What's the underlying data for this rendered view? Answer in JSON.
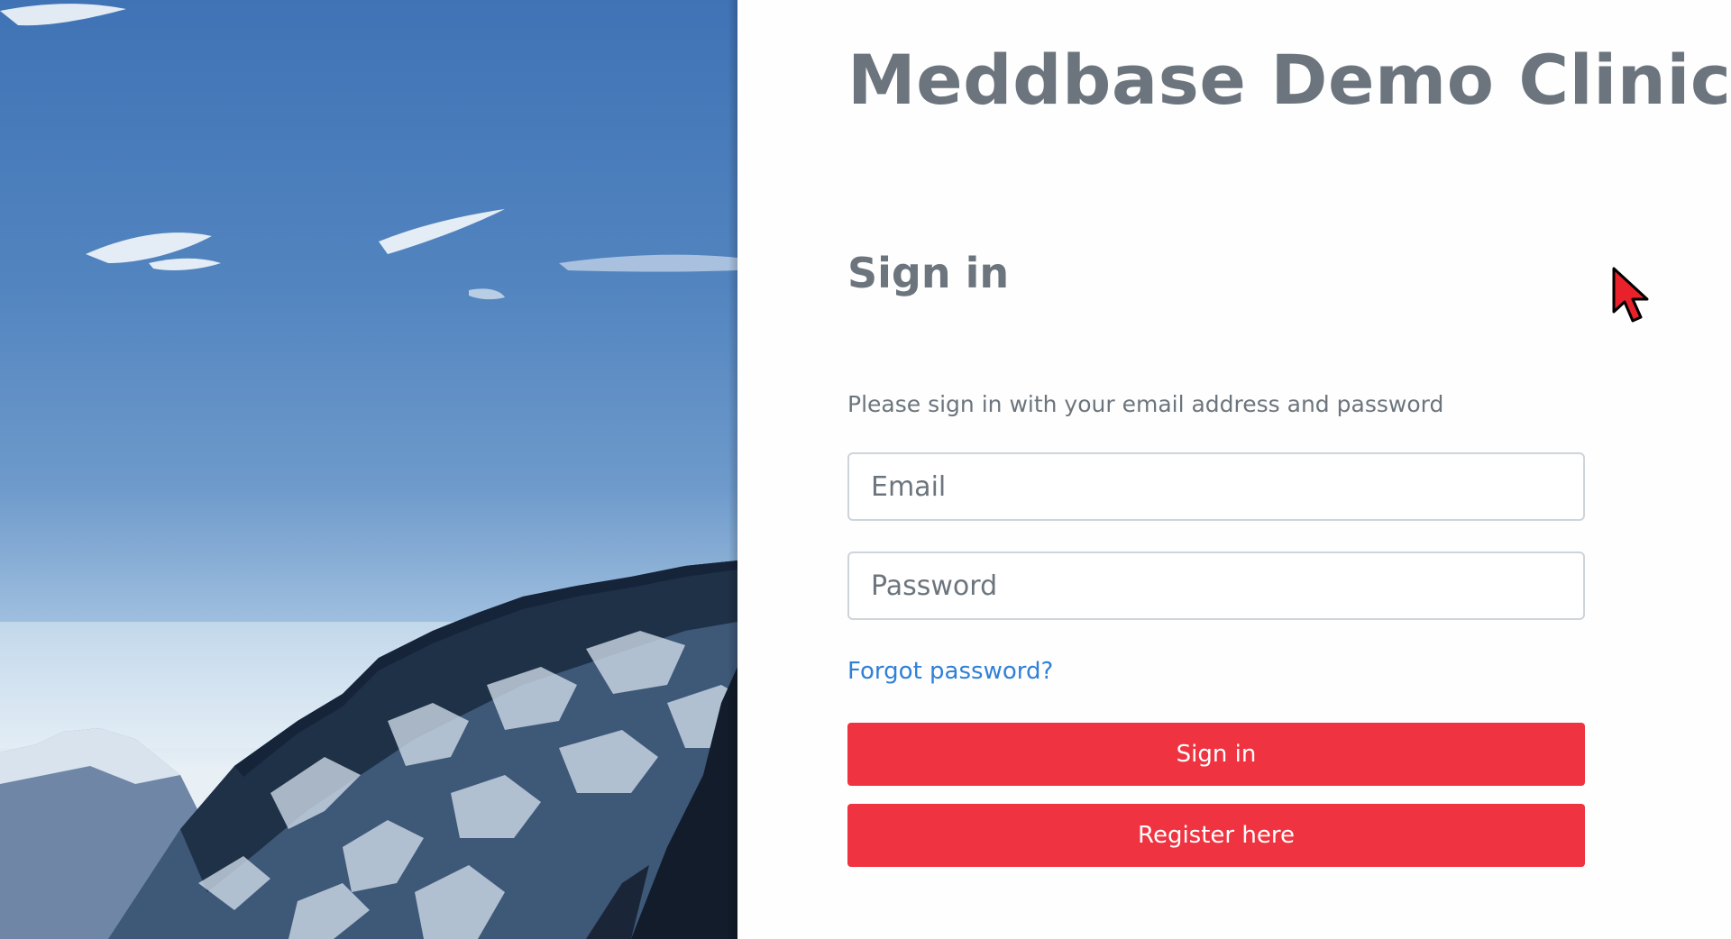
{
  "clinic": {
    "name": "Meddbase Demo Clinic"
  },
  "signin": {
    "heading": "Sign in",
    "instructions": "Please sign in with your email address and password",
    "email_placeholder": "Email",
    "password_placeholder": "Password",
    "forgot_label": "Forgot password?",
    "signin_button": "Sign in",
    "register_button": "Register here"
  },
  "colors": {
    "accent": "#ef3340",
    "link": "#2f80d6",
    "text_muted": "#6c757d",
    "cursor": "#e8212a"
  },
  "icons": {
    "cursor": "mouse-pointer-arrow"
  }
}
